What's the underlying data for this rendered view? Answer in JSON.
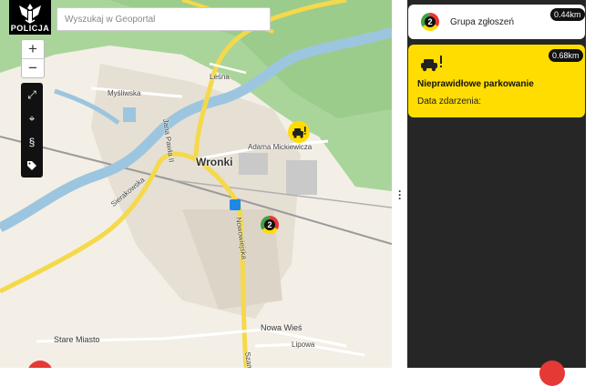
{
  "logo": {
    "text": "POLICJA",
    "icon": "police-eagle-icon"
  },
  "search": {
    "placeholder": "Wyszukaj w Geoportal"
  },
  "map_controls": {
    "zoom_in": "+",
    "zoom_out": "−",
    "tools": [
      {
        "icon": "fullscreen-icon",
        "glyph": "⤢"
      },
      {
        "icon": "locate-icon",
        "glyph": "⌖"
      },
      {
        "icon": "paragraph-icon",
        "glyph": "§"
      },
      {
        "icon": "tag-icon",
        "glyph": "🏷"
      }
    ]
  },
  "map_labels": {
    "town": "Wronki",
    "lesna": "Leśna",
    "mysliwska": "Myśliwska",
    "jana_pawla": "Jana Pawła II",
    "mickiewicza": "Adama Mickiewicza",
    "sierakowska": "Sierakowska",
    "nowowiejska": "Nowowiejska",
    "nowa_wies": "Nowa Wieś",
    "stare_miasto": "Stare Miasto",
    "lipowa": "Lipowa",
    "szam": "Szam"
  },
  "markers": {
    "cluster_count": "2",
    "parking_icon": "car-warning-icon"
  },
  "panel": {
    "group": {
      "title": "Grupa zgłoszeń",
      "count": "2",
      "distance": "0.44km"
    },
    "report": {
      "title": "Nieprawidłowe parkowanie",
      "date_label": "Data zdarzenia:",
      "distance": "0.68km",
      "icon": "car-warning-icon"
    }
  },
  "colors": {
    "accent_yellow": "#ffdd00",
    "panel_bg": "#262626",
    "river": "#9cc6df",
    "forest": "#a9d59a"
  }
}
